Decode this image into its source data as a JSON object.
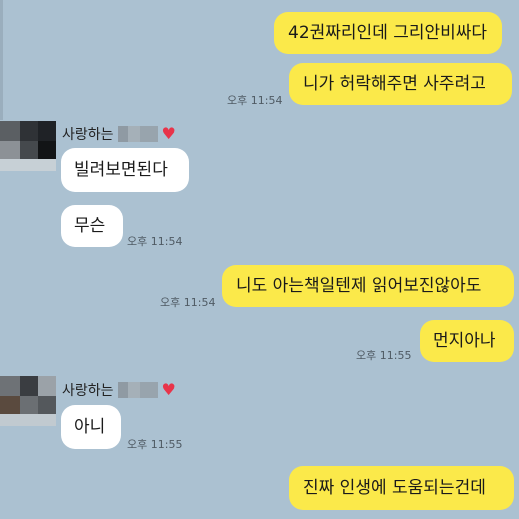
{
  "messages": [
    {
      "text": "42권짜리인데 그리안비싸다",
      "side": "mine"
    },
    {
      "text": "니가 허락해주면 사주려고",
      "side": "mine",
      "time": "오후 11:54"
    },
    {
      "text": "빌려보면된다",
      "side": "theirs"
    },
    {
      "text": "무슨",
      "side": "theirs",
      "time": "오후 11:54"
    },
    {
      "text": "니도 아는책일텐제 읽어보진않아도",
      "side": "mine",
      "time": "오후 11:54"
    },
    {
      "text": "먼지아나",
      "side": "mine",
      "time": "오후 11:55"
    },
    {
      "text": "아니",
      "side": "theirs",
      "time": "오후 11:55"
    },
    {
      "text": "진짜 인생에 도움되는건데",
      "side": "mine"
    }
  ],
  "sender": {
    "name_prefix": "사랑하는",
    "name_icon": "heart-icon"
  },
  "colors": {
    "background": "#abc1d1",
    "mine_bubble": "#fbe94a",
    "theirs_bubble": "#ffffff",
    "heart": "#e8344a"
  }
}
